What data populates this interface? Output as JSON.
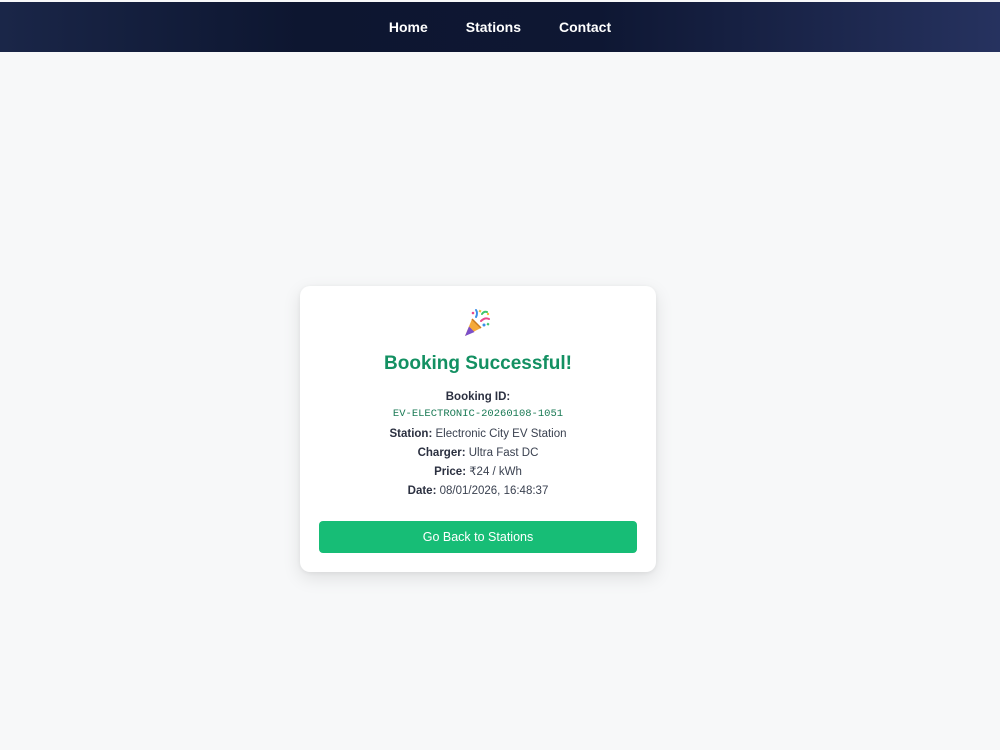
{
  "nav": {
    "items": [
      {
        "label": "Home"
      },
      {
        "label": "Stations"
      },
      {
        "label": "Contact"
      }
    ]
  },
  "card": {
    "icon": "party-popper-icon",
    "title": "Booking Successful!",
    "booking_id_label": "Booking ID:",
    "booking_id_value": "EV-ELECTRONIC-20260108-1051",
    "station_label": "Station:",
    "station_value": "Electronic City EV Station",
    "charger_label": "Charger:",
    "charger_value": "Ultra Fast DC",
    "price_label": "Price:",
    "price_value": "₹24 / kWh",
    "date_label": "Date:",
    "date_value": "08/01/2026, 16:48:37",
    "button_label": "Go Back to Stations"
  },
  "colors": {
    "title": "#139062",
    "button": "#17bd76",
    "navbar": "#0d1630",
    "background": "#f7f8f9"
  }
}
